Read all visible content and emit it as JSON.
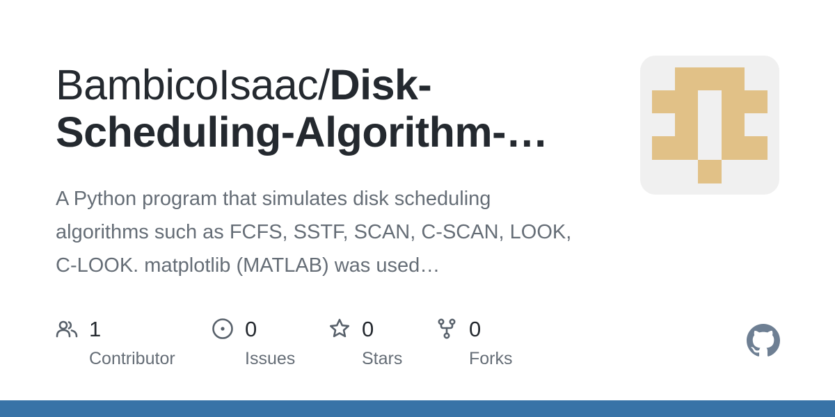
{
  "repo": {
    "owner": "BambicoIsaac/",
    "name": "Disk-Scheduling-Algorithm-…",
    "description": "A Python program that simulates disk scheduling algorithms such as FCFS, SSTF, SCAN, C-SCAN, LOOK, C-LOOK. matplotlib (MATLAB) was used…"
  },
  "stats": [
    {
      "icon": "people-icon",
      "count": "1",
      "label": "Contributor"
    },
    {
      "icon": "issue-opened-icon",
      "count": "0",
      "label": "Issues"
    },
    {
      "icon": "star-icon",
      "count": "0",
      "label": "Stars"
    },
    {
      "icon": "repo-forked-icon",
      "count": "0",
      "label": "Forks"
    }
  ],
  "colors": {
    "avatar_background": "#f0f0f0",
    "avatar_foreground": "#e1c187",
    "footer_bar": "#3873a7",
    "logo": "#6e7f93",
    "muted_text": "#656d76"
  },
  "icons": {
    "avatar": "identicon",
    "logo": "github-mark-icon"
  }
}
